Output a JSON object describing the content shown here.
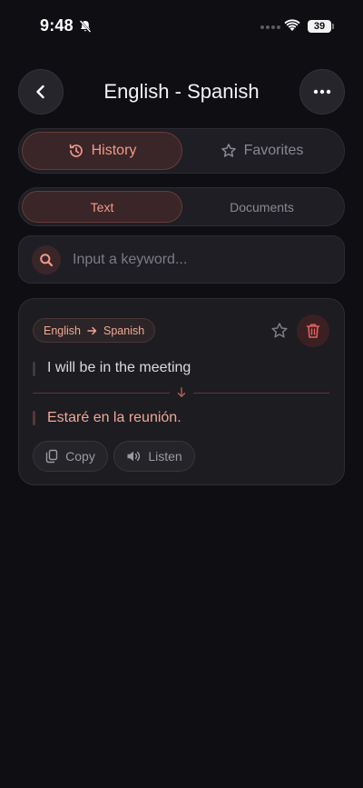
{
  "status_bar": {
    "time": "9:48",
    "battery": "39"
  },
  "header": {
    "title": "English - Spanish"
  },
  "tabs": [
    {
      "label": "History",
      "active": true,
      "icon": "history-icon"
    },
    {
      "label": "Favorites",
      "active": false,
      "icon": "star-icon"
    }
  ],
  "subtabs": [
    {
      "label": "Text",
      "active": true
    },
    {
      "label": "Documents",
      "active": false
    }
  ],
  "search": {
    "placeholder": "Input a keyword...",
    "value": ""
  },
  "history_card": {
    "source_lang": "English",
    "target_lang": "Spanish",
    "source_text": "I will be in the meeting",
    "translated_text": "Estaré en la reunión.",
    "copy_label": "Copy",
    "listen_label": "Listen"
  },
  "colors": {
    "background": "#0f0e12",
    "accent": "#f19a88",
    "surface": "#1f1e24",
    "danger": "#e0625f"
  }
}
